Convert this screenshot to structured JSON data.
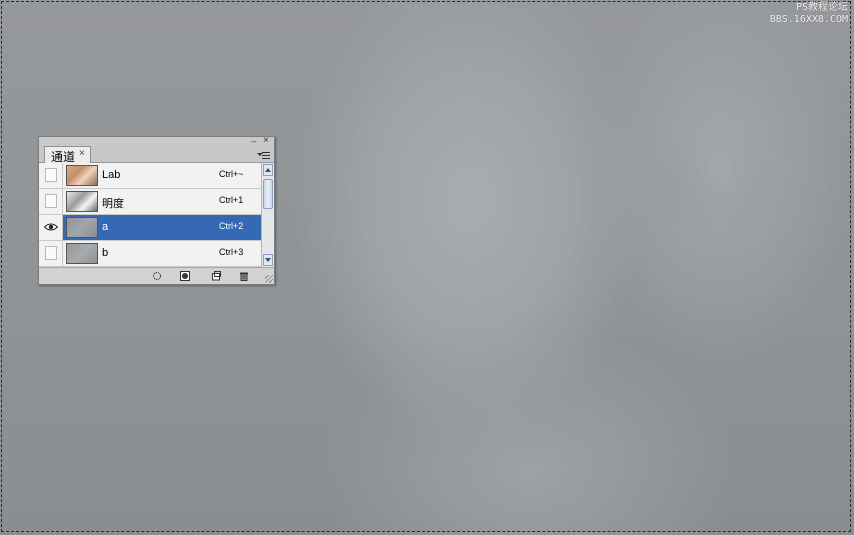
{
  "watermark": {
    "line1": "PS教程论坛",
    "line2": "BBS.16XX8.COM"
  },
  "panel": {
    "tab_label": "通道",
    "tab_close": "×",
    "minimize": "–",
    "close": "×",
    "channels": [
      {
        "name": "Lab",
        "shortcut": "Ctrl+~",
        "visible": false,
        "selected": false,
        "thumb": "lab"
      },
      {
        "name": "明度",
        "shortcut": "Ctrl+1",
        "visible": false,
        "selected": false,
        "thumb": "lum"
      },
      {
        "name": "a",
        "shortcut": "Ctrl+2",
        "visible": true,
        "selected": true,
        "thumb": "a"
      },
      {
        "name": "b",
        "shortcut": "Ctrl+3",
        "visible": false,
        "selected": false,
        "thumb": "b"
      }
    ],
    "footer_icons": [
      "load-selection-icon",
      "save-selection-icon",
      "new-channel-icon",
      "delete-channel-icon"
    ]
  },
  "colors": {
    "selected_row": "#3669b4",
    "panel_bg": "#d6d6d6"
  }
}
